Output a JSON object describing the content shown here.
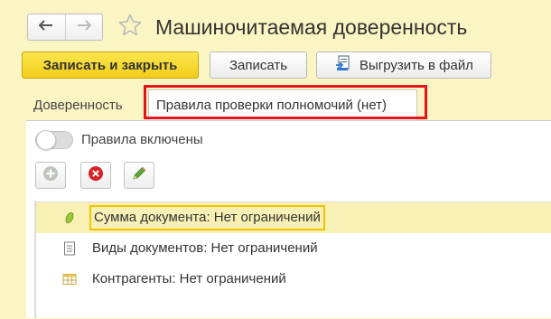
{
  "window": {
    "title": "Машиночитаемая доверенность"
  },
  "nav": {
    "back_icon": "arrow-left-icon",
    "forward_icon": "arrow-right-icon"
  },
  "favorite": {
    "icon": "star-icon"
  },
  "toolbar": {
    "save_close_label": "Записать и закрыть",
    "save_label": "Записать",
    "export_label": "Выгрузить в файл"
  },
  "tabs": [
    {
      "label": "Доверенность",
      "active": false
    },
    {
      "label": "Правила проверки полномочий (нет)",
      "active": true
    }
  ],
  "rules": {
    "toggle_label": "Правила включены",
    "enabled": false
  },
  "list": {
    "items": [
      {
        "label": "Сумма документа: Нет ограничений",
        "icon": "coin-icon",
        "selected": true
      },
      {
        "label": "Виды документов: Нет ограничений",
        "icon": "document-icon",
        "selected": false
      },
      {
        "label": "Контрагенты: Нет ограничений",
        "icon": "table-icon",
        "selected": false
      }
    ]
  },
  "colors": {
    "accent_yellow": "#f2cd1a",
    "highlight_red": "#e8121b",
    "background": "#fbf5c4",
    "selected_row": "#f8f0b4"
  }
}
